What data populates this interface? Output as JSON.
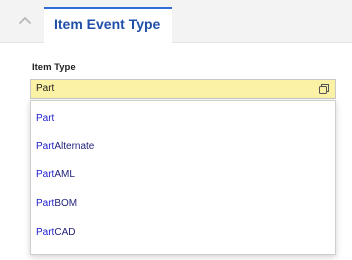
{
  "section": {
    "tab_label": "Item Event Type",
    "collapse_icon": "chevron-up-icon"
  },
  "field": {
    "label": "Item Type",
    "value": "Part",
    "lookup_icon": "copy-icon",
    "background_color": "#fbf2a6"
  },
  "dropdown": {
    "typed_prefix": "Part",
    "options": [
      {
        "match": "Part",
        "rest": ""
      },
      {
        "match": "Part",
        "rest": "Alternate"
      },
      {
        "match": "Part",
        "rest": "AML"
      },
      {
        "match": "Part",
        "rest": "BOM"
      },
      {
        "match": "Part",
        "rest": "CAD"
      }
    ]
  },
  "colors": {
    "tab_accent": "#2e6fd6",
    "option_text": "#22227a",
    "match_highlight": "#1d1dcc"
  }
}
